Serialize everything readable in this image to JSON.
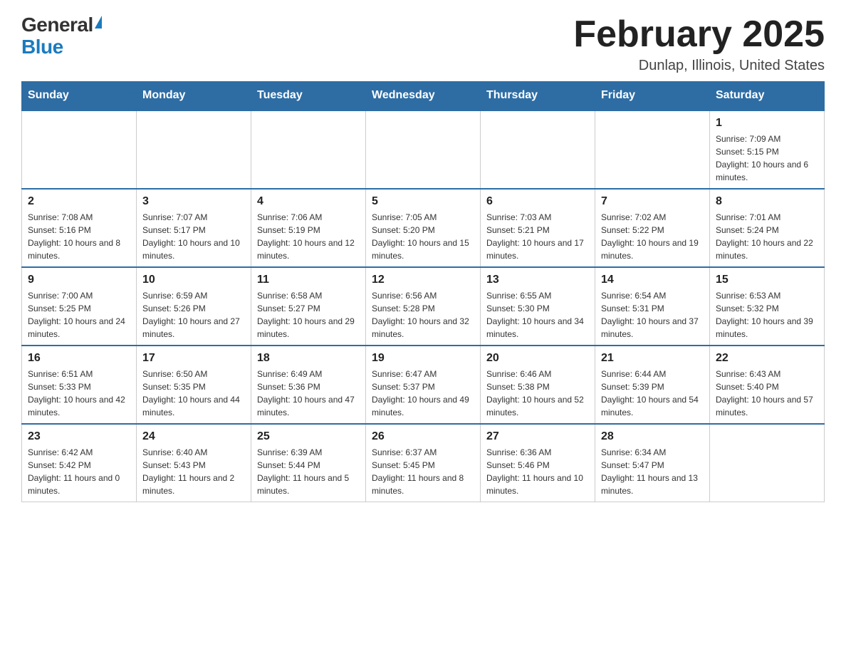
{
  "logo": {
    "general": "General",
    "blue": "Blue"
  },
  "title": "February 2025",
  "location": "Dunlap, Illinois, United States",
  "days_of_week": [
    "Sunday",
    "Monday",
    "Tuesday",
    "Wednesday",
    "Thursday",
    "Friday",
    "Saturday"
  ],
  "weeks": [
    [
      {
        "day": "",
        "info": ""
      },
      {
        "day": "",
        "info": ""
      },
      {
        "day": "",
        "info": ""
      },
      {
        "day": "",
        "info": ""
      },
      {
        "day": "",
        "info": ""
      },
      {
        "day": "",
        "info": ""
      },
      {
        "day": "1",
        "info": "Sunrise: 7:09 AM\nSunset: 5:15 PM\nDaylight: 10 hours and 6 minutes."
      }
    ],
    [
      {
        "day": "2",
        "info": "Sunrise: 7:08 AM\nSunset: 5:16 PM\nDaylight: 10 hours and 8 minutes."
      },
      {
        "day": "3",
        "info": "Sunrise: 7:07 AM\nSunset: 5:17 PM\nDaylight: 10 hours and 10 minutes."
      },
      {
        "day": "4",
        "info": "Sunrise: 7:06 AM\nSunset: 5:19 PM\nDaylight: 10 hours and 12 minutes."
      },
      {
        "day": "5",
        "info": "Sunrise: 7:05 AM\nSunset: 5:20 PM\nDaylight: 10 hours and 15 minutes."
      },
      {
        "day": "6",
        "info": "Sunrise: 7:03 AM\nSunset: 5:21 PM\nDaylight: 10 hours and 17 minutes."
      },
      {
        "day": "7",
        "info": "Sunrise: 7:02 AM\nSunset: 5:22 PM\nDaylight: 10 hours and 19 minutes."
      },
      {
        "day": "8",
        "info": "Sunrise: 7:01 AM\nSunset: 5:24 PM\nDaylight: 10 hours and 22 minutes."
      }
    ],
    [
      {
        "day": "9",
        "info": "Sunrise: 7:00 AM\nSunset: 5:25 PM\nDaylight: 10 hours and 24 minutes."
      },
      {
        "day": "10",
        "info": "Sunrise: 6:59 AM\nSunset: 5:26 PM\nDaylight: 10 hours and 27 minutes."
      },
      {
        "day": "11",
        "info": "Sunrise: 6:58 AM\nSunset: 5:27 PM\nDaylight: 10 hours and 29 minutes."
      },
      {
        "day": "12",
        "info": "Sunrise: 6:56 AM\nSunset: 5:28 PM\nDaylight: 10 hours and 32 minutes."
      },
      {
        "day": "13",
        "info": "Sunrise: 6:55 AM\nSunset: 5:30 PM\nDaylight: 10 hours and 34 minutes."
      },
      {
        "day": "14",
        "info": "Sunrise: 6:54 AM\nSunset: 5:31 PM\nDaylight: 10 hours and 37 minutes."
      },
      {
        "day": "15",
        "info": "Sunrise: 6:53 AM\nSunset: 5:32 PM\nDaylight: 10 hours and 39 minutes."
      }
    ],
    [
      {
        "day": "16",
        "info": "Sunrise: 6:51 AM\nSunset: 5:33 PM\nDaylight: 10 hours and 42 minutes."
      },
      {
        "day": "17",
        "info": "Sunrise: 6:50 AM\nSunset: 5:35 PM\nDaylight: 10 hours and 44 minutes."
      },
      {
        "day": "18",
        "info": "Sunrise: 6:49 AM\nSunset: 5:36 PM\nDaylight: 10 hours and 47 minutes."
      },
      {
        "day": "19",
        "info": "Sunrise: 6:47 AM\nSunset: 5:37 PM\nDaylight: 10 hours and 49 minutes."
      },
      {
        "day": "20",
        "info": "Sunrise: 6:46 AM\nSunset: 5:38 PM\nDaylight: 10 hours and 52 minutes."
      },
      {
        "day": "21",
        "info": "Sunrise: 6:44 AM\nSunset: 5:39 PM\nDaylight: 10 hours and 54 minutes."
      },
      {
        "day": "22",
        "info": "Sunrise: 6:43 AM\nSunset: 5:40 PM\nDaylight: 10 hours and 57 minutes."
      }
    ],
    [
      {
        "day": "23",
        "info": "Sunrise: 6:42 AM\nSunset: 5:42 PM\nDaylight: 11 hours and 0 minutes."
      },
      {
        "day": "24",
        "info": "Sunrise: 6:40 AM\nSunset: 5:43 PM\nDaylight: 11 hours and 2 minutes."
      },
      {
        "day": "25",
        "info": "Sunrise: 6:39 AM\nSunset: 5:44 PM\nDaylight: 11 hours and 5 minutes."
      },
      {
        "day": "26",
        "info": "Sunrise: 6:37 AM\nSunset: 5:45 PM\nDaylight: 11 hours and 8 minutes."
      },
      {
        "day": "27",
        "info": "Sunrise: 6:36 AM\nSunset: 5:46 PM\nDaylight: 11 hours and 10 minutes."
      },
      {
        "day": "28",
        "info": "Sunrise: 6:34 AM\nSunset: 5:47 PM\nDaylight: 11 hours and 13 minutes."
      },
      {
        "day": "",
        "info": ""
      }
    ]
  ]
}
